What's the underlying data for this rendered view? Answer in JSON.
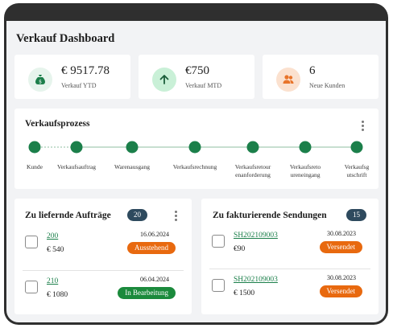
{
  "dashboard": {
    "title": "Verkauf Dashboard"
  },
  "kpis": [
    {
      "value": "€ 9517.78",
      "label": "Verkauf YTD",
      "icon": "money-bag-icon",
      "color": "#1b7f4a",
      "bg": "#e6f4ec"
    },
    {
      "value": "€750",
      "label": "Verkauf MTD",
      "icon": "arrow-up-icon",
      "color": "#1b7f4a",
      "bg": "#c9f0d7"
    },
    {
      "value": "6",
      "label": "Neue Kunden",
      "icon": "users-icon",
      "color": "#e8742a",
      "bg": "#fbe1cf"
    }
  ],
  "process": {
    "title": "Verkaufsprozess",
    "steps": [
      "Kunde",
      "Verkaufsauftrag",
      "Warenausgang",
      "Verkaufsrechnung",
      "Verkaufsretour\nenanforderung",
      "Verkaufsreto\nureneingang",
      "Verkaufsg\nutschrift"
    ]
  },
  "orders": {
    "title": "Zu liefernde Aufträge",
    "count": "20",
    "items": [
      {
        "id": "200",
        "amount": "€ 540",
        "date": "16.06.2024",
        "status": "Ausstehend",
        "status_color": "#e8690f"
      },
      {
        "id": "210",
        "amount": "€ 1080",
        "date": "06.04.2024",
        "status": "In Bearbeitung",
        "status_color": "#1b8a3c"
      }
    ]
  },
  "shipments": {
    "title": "Zu fakturierende Sendungen",
    "count": "15",
    "items": [
      {
        "id": "SH202109003",
        "amount": "€90",
        "date": "30.08.2023",
        "status": "Versendet",
        "status_color": "#e8690f"
      },
      {
        "id": "SH202109003",
        "amount": "€ 1500",
        "date": "30.08.2023",
        "status": "Versendet",
        "status_color": "#e8690f"
      }
    ]
  },
  "colors": {
    "accent": "#1b7f4a",
    "badge_dark": "#2e4a5e"
  }
}
